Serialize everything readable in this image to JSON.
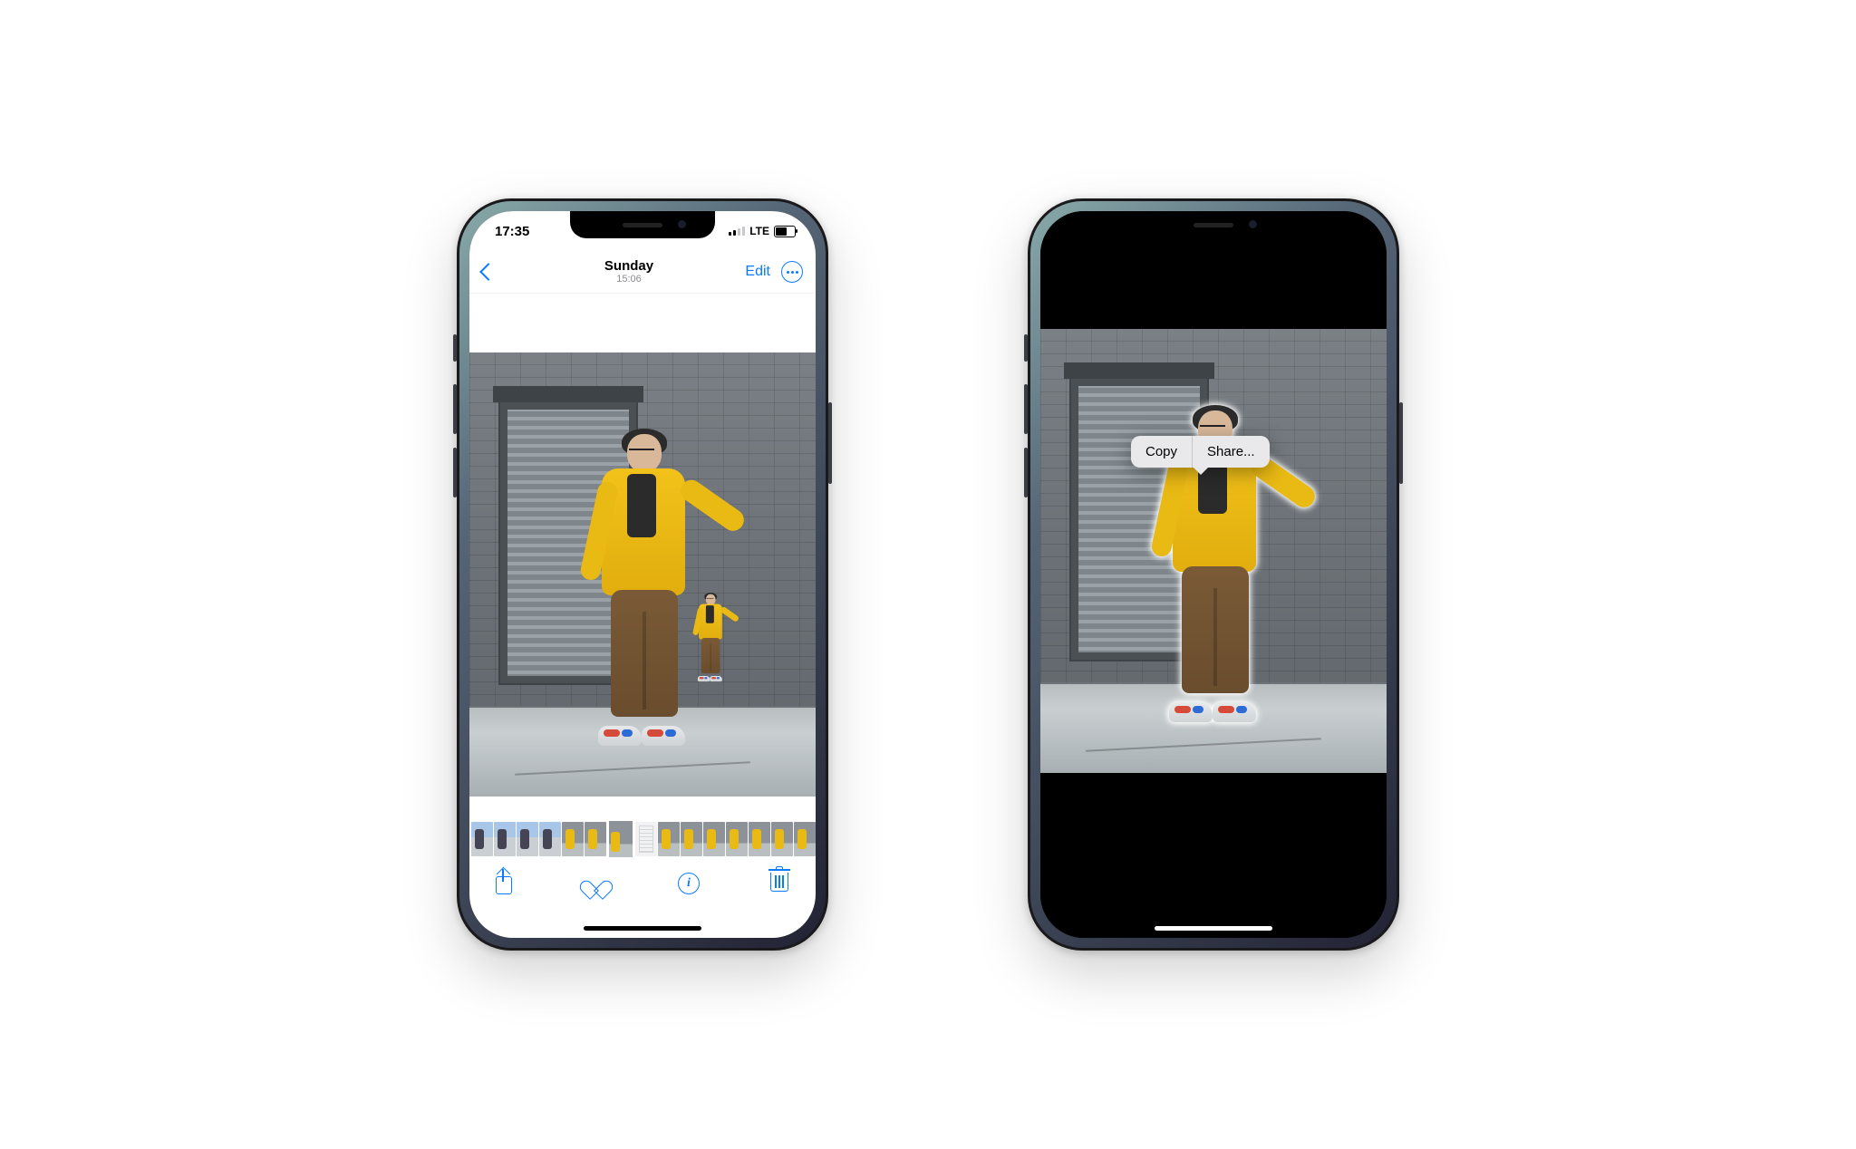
{
  "left_phone": {
    "status": {
      "time": "17:35",
      "network_label": "LTE"
    },
    "nav": {
      "title": "Sunday",
      "subtitle": "15:06",
      "edit_label": "Edit"
    },
    "toolbar": {
      "info_glyph": "i"
    }
  },
  "right_phone": {
    "context_menu": {
      "copy_label": "Copy",
      "share_label": "Share..."
    }
  }
}
